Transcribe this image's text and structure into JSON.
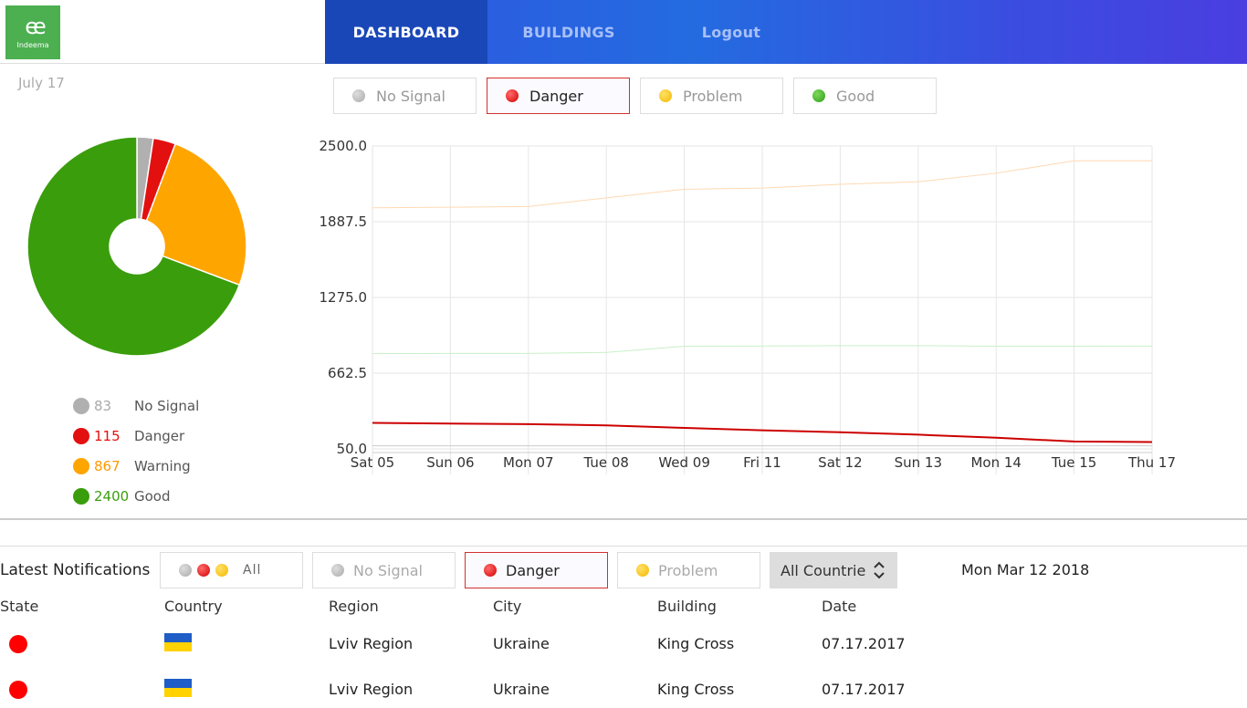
{
  "header": {
    "logo_text": "Indeema",
    "nav": [
      {
        "label": "DASHBOARD",
        "active": true
      },
      {
        "label": "BUILDINGS",
        "active": false
      },
      {
        "label": "Logout",
        "active": false
      }
    ]
  },
  "dashboard": {
    "date_label": "July 17",
    "filters": [
      {
        "label": "No Signal",
        "status": "nosignal",
        "selected": false
      },
      {
        "label": "Danger",
        "status": "danger",
        "selected": true
      },
      {
        "label": "Problem",
        "status": "problem",
        "selected": false
      },
      {
        "label": "Good",
        "status": "good",
        "selected": false
      }
    ],
    "legend": [
      {
        "value": "83",
        "label": "No Signal",
        "color": "#b0b0b0"
      },
      {
        "value": "115",
        "label": "Danger",
        "color": "#e31010"
      },
      {
        "value": "867",
        "label": "Warning",
        "color": "#ffa500"
      },
      {
        "value": "2400",
        "label": "Good",
        "color": "#3a9d0c"
      }
    ]
  },
  "chart_data": [
    {
      "type": "pie",
      "donut": true,
      "categories": [
        "No Signal",
        "Danger",
        "Warning",
        "Good"
      ],
      "values": [
        83,
        115,
        867,
        2400
      ],
      "colors": [
        "#b0b0b0",
        "#e31010",
        "#ffa500",
        "#3a9d0c"
      ]
    },
    {
      "type": "line",
      "x": [
        "Sat 05",
        "Sun 06",
        "Mon 07",
        "Tue 08",
        "Wed 09",
        "Fri 11",
        "Sat 12",
        "Sun 13",
        "Mon 14",
        "Tue 15",
        "Thu 17"
      ],
      "ylim": [
        50,
        2500
      ],
      "yticks": [
        "2500.0",
        "1887.5",
        "1275.0",
        "662.5",
        "50.0"
      ],
      "grid": true,
      "series": [
        {
          "color": "#ffd9b3",
          "values": [
            2000,
            2005,
            2010,
            2080,
            2150,
            2160,
            2190,
            2210,
            2280,
            2380,
            2380
          ]
        },
        {
          "color": "#c8f0c8",
          "values": [
            820,
            822,
            822,
            830,
            880,
            882,
            885,
            885,
            880,
            880,
            882
          ]
        },
        {
          "color": "#cc0000",
          "values": [
            260,
            255,
            250,
            240,
            220,
            200,
            185,
            165,
            140,
            110,
            105
          ]
        },
        {
          "color": "#cccccc",
          "values": [
            75,
            75,
            75,
            75,
            75,
            75,
            75,
            75,
            75,
            75,
            75
          ]
        }
      ]
    }
  ],
  "notifications": {
    "title": "Latest Notifications",
    "filters": {
      "all_label": "ALL",
      "nosignal_label": "No Signal",
      "danger_label": "Danger",
      "problem_label": "Problem"
    },
    "country_select": "All Countries",
    "date": "Mon Mar 12 2018",
    "columns": [
      "State",
      "Country",
      "Region",
      "City",
      "Building",
      "Date"
    ],
    "rows": [
      {
        "state": "danger",
        "country_flag": "ukraine-flag",
        "region": "Lviv Region",
        "city": "Ukraine",
        "building": "King Cross",
        "date": "07.17.2017"
      },
      {
        "state": "danger",
        "country_flag": "ukraine-flag",
        "region": "Lviv Region",
        "city": "Ukraine",
        "building": "King Cross",
        "date": "07.17.2017"
      }
    ]
  }
}
